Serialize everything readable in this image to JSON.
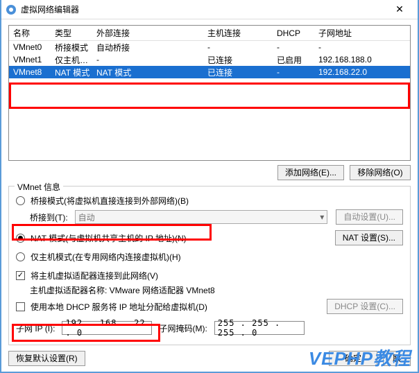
{
  "titlebar": {
    "title": "虚拟网络编辑器"
  },
  "columns": {
    "name": "名称",
    "type": "类型",
    "external": "外部连接",
    "host": "主机连接",
    "dhcp": "DHCP",
    "subnet": "子网地址"
  },
  "rows": [
    {
      "name": "VMnet0",
      "type": "桥接模式",
      "external": "自动桥接",
      "host": "-",
      "dhcp": "-",
      "subnet": "-"
    },
    {
      "name": "VMnet1",
      "type": "仅主机…",
      "external": "-",
      "host": "已连接",
      "dhcp": "已启用",
      "subnet": "192.168.188.0"
    },
    {
      "name": "VMnet8",
      "type": "NAT 模式",
      "external": "NAT 模式",
      "host": "已连接",
      "dhcp": "-",
      "subnet": "192.168.22.0"
    }
  ],
  "buttons": {
    "add_net": "添加网络(E)...",
    "remove_net": "移除网络(O)",
    "auto_set": "自动设置(U)...",
    "nat_set": "NAT 设置(S)...",
    "dhcp_set": "DHCP 设置(C)...",
    "restore": "恢复默认设置(R)",
    "ok": "确定",
    "cancel": "取"
  },
  "group": {
    "title": "VMnet 信息",
    "bridge_opt": "桥接模式(将虚拟机直接连接到外部网络)(B)",
    "bridge_to": "桥接到(T):",
    "bridge_value": "自动",
    "nat_opt": "NAT 模式(与虚拟机共享主机的 IP 地址)(N)",
    "host_only_opt": "仅主机模式(在专用网络内连接虚拟机)(H)",
    "connect_adapter": "将主机虚拟适配器连接到此网络(V)",
    "adapter_name_label": "主机虚拟适配器名称: VMware 网络适配器 VMnet8",
    "dhcp_assign": "使用本地 DHCP 服务将 IP 地址分配给虚拟机(D)",
    "subnet_ip_label": "子网 IP (I):",
    "subnet_ip_value": "192 . 168 . 22 . 0",
    "subnet_mask_label": "子网掩码(M):",
    "subnet_mask_value": "255 . 255 . 255 . 0"
  },
  "watermark": "VEPHP教程"
}
